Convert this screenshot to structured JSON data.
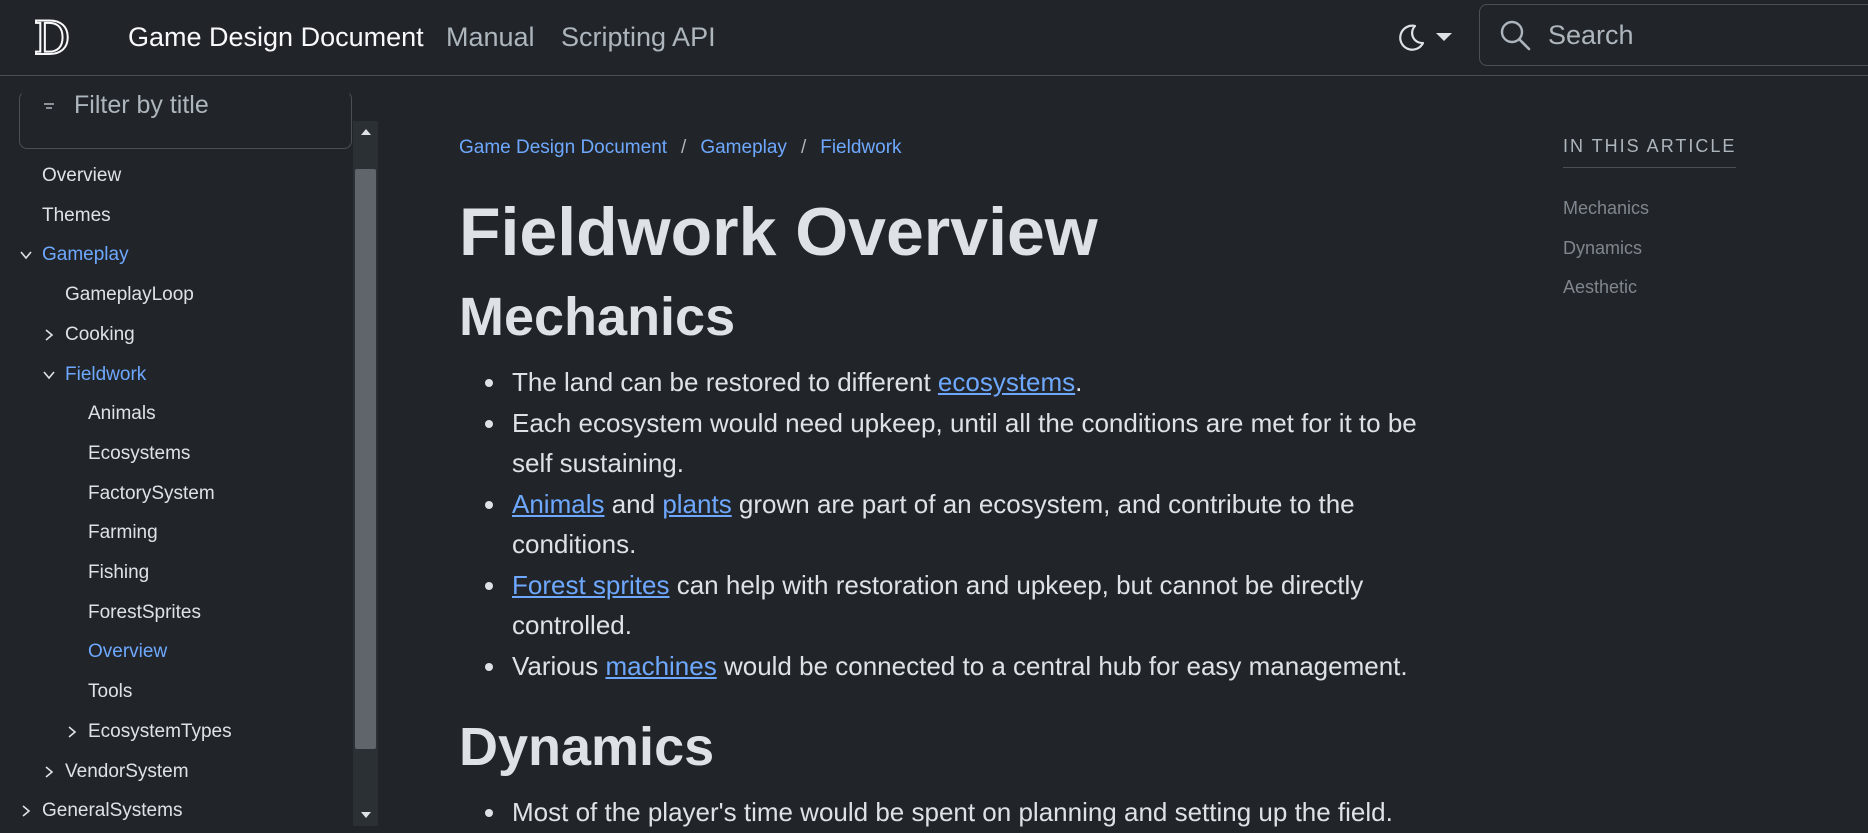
{
  "header": {
    "logo_letter": "D",
    "brand": "Game Design Document",
    "nav": [
      "Manual",
      "Scripting API"
    ],
    "search_placeholder": "Search"
  },
  "sidebar": {
    "filter_placeholder": "Filter by title",
    "items": [
      {
        "label": "Overview",
        "level": 1,
        "expandable": false
      },
      {
        "label": "Themes",
        "level": 1,
        "expandable": false
      },
      {
        "label": "Gameplay",
        "level": 1,
        "expandable": true,
        "expanded": true,
        "active": true
      },
      {
        "label": "GameplayLoop",
        "level": 2,
        "expandable": false
      },
      {
        "label": "Cooking",
        "level": 2,
        "expandable": true,
        "expanded": false
      },
      {
        "label": "Fieldwork",
        "level": 2,
        "expandable": true,
        "expanded": true,
        "active": true
      },
      {
        "label": "Animals",
        "level": 3,
        "expandable": false
      },
      {
        "label": "Ecosystems",
        "level": 3,
        "expandable": false
      },
      {
        "label": "FactorySystem",
        "level": 3,
        "expandable": false
      },
      {
        "label": "Farming",
        "level": 3,
        "expandable": false
      },
      {
        "label": "Fishing",
        "level": 3,
        "expandable": false
      },
      {
        "label": "ForestSprites",
        "level": 3,
        "expandable": false
      },
      {
        "label": "Overview",
        "level": 3,
        "expandable": false,
        "active": true
      },
      {
        "label": "Tools",
        "level": 3,
        "expandable": false
      },
      {
        "label": "EcosystemTypes",
        "level": 3,
        "expandable": true,
        "expanded": false
      },
      {
        "label": "VendorSystem",
        "level": 2,
        "expandable": true,
        "expanded": false
      },
      {
        "label": "GeneralSystems",
        "level": 1,
        "expandable": true,
        "expanded": false
      }
    ]
  },
  "breadcrumb": [
    "Game Design Document",
    "Gameplay",
    "Fieldwork"
  ],
  "article": {
    "title": "Fieldwork Overview",
    "sections": [
      {
        "heading": "Mechanics",
        "bullets": [
          [
            {
              "t": "The land can be restored to different "
            },
            {
              "link": "ecosystems"
            },
            {
              "t": "."
            }
          ],
          [
            {
              "t": "Each ecosystem would need upkeep, until all the conditions are met for it to be self sustaining."
            }
          ],
          [
            {
              "link": "Animals"
            },
            {
              "t": " and "
            },
            {
              "link": "plants"
            },
            {
              "t": " grown are part of an ecosystem, and contribute to the conditions."
            }
          ],
          [
            {
              "link": "Forest sprites"
            },
            {
              "t": " can help with restoration and upkeep, but cannot be directly controlled."
            }
          ],
          [
            {
              "t": "Various "
            },
            {
              "link": "machines"
            },
            {
              "t": " would be connected to a central hub for easy management."
            }
          ]
        ]
      },
      {
        "heading": "Dynamics",
        "bullets": [
          [
            {
              "t": "Most of the player's time would be spent on planning and setting up the field."
            }
          ]
        ]
      }
    ]
  },
  "article_toc": {
    "title": "IN THIS ARTICLE",
    "links": [
      "Mechanics",
      "Dynamics",
      "Aesthetic"
    ]
  },
  "colors": {
    "background": "#212529",
    "text": "#dee2e6",
    "link": "#6ea8fe",
    "muted": "#adb5bd"
  }
}
